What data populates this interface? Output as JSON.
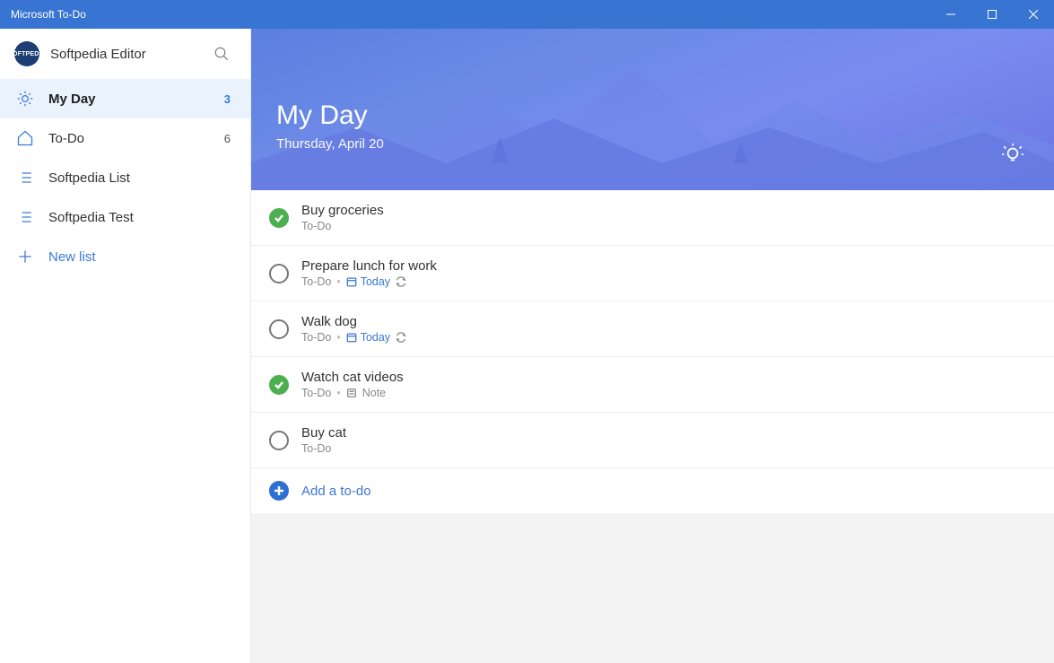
{
  "window": {
    "title": "Microsoft To-Do"
  },
  "profile": {
    "name": "Softpedia Editor",
    "avatar_text": "SOFTPEDIA"
  },
  "sidebar": {
    "items": [
      {
        "label": "My Day",
        "count": "3"
      },
      {
        "label": "To-Do",
        "count": "6"
      },
      {
        "label": "Softpedia List",
        "count": ""
      },
      {
        "label": "Softpedia Test",
        "count": ""
      }
    ],
    "new_list_label": "New list"
  },
  "hero": {
    "title": "My Day",
    "subtitle": "Thursday, April 20"
  },
  "tasks": [
    {
      "title": "Buy groceries",
      "list": "To-Do",
      "done": true,
      "due": "",
      "note": false,
      "repeat": false
    },
    {
      "title": "Prepare lunch for work",
      "list": "To-Do",
      "done": false,
      "due": "Today",
      "note": false,
      "repeat": true
    },
    {
      "title": "Walk dog",
      "list": "To-Do",
      "done": false,
      "due": "Today",
      "note": false,
      "repeat": true
    },
    {
      "title": "Watch cat videos",
      "list": "To-Do",
      "done": true,
      "due": "",
      "note": true,
      "repeat": false
    },
    {
      "title": "Buy cat",
      "list": "To-Do",
      "done": false,
      "due": "",
      "note": false,
      "repeat": false
    }
  ],
  "labels": {
    "note": "Note",
    "add_todo": "Add a to-do"
  }
}
